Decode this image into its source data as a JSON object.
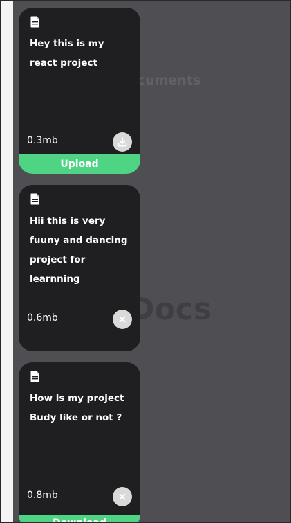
{
  "background": {
    "title": "Docs",
    "subtitle": "Documents"
  },
  "colors": {
    "card": "#1f1f22",
    "accent": "#4fd483",
    "background": "#4f4e52"
  },
  "cards": [
    {
      "icon": "file-icon",
      "text": "Hey this is my react project",
      "size": "0.3mb",
      "action_icon": "download-icon",
      "button_label": "Upload"
    },
    {
      "icon": "file-icon",
      "text": "Hii this is very fuuny and dancing project for learnning",
      "size": "0.6mb",
      "action_icon": "close-icon"
    },
    {
      "icon": "file-icon",
      "text": "How is my project Budy like or not ?",
      "size": "0.8mb",
      "action_icon": "close-icon",
      "button_label": "Download"
    }
  ]
}
